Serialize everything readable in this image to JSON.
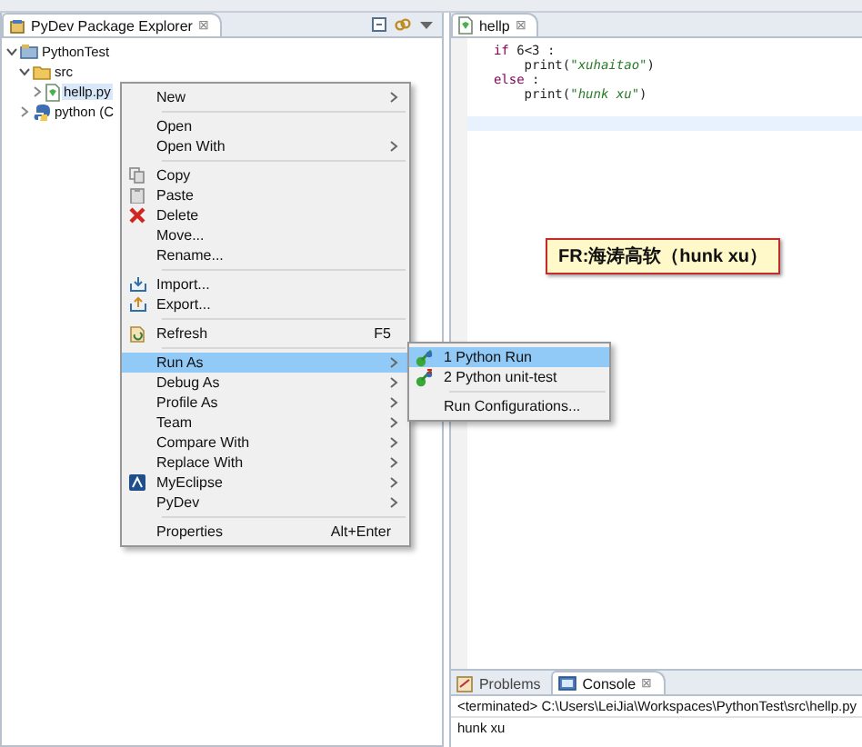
{
  "explorer": {
    "tab": {
      "label": "PyDev Package Explorer",
      "selected": true,
      "close": "⊠"
    },
    "tree": [
      {
        "label": "PythonTest",
        "kind": "project",
        "expanded": true,
        "selected": false,
        "children": [
          {
            "label": "src",
            "kind": "folder",
            "expanded": true,
            "selected": false,
            "children": [
              {
                "label": "hellp.py",
                "kind": "file",
                "expanded": false,
                "selected": true
              }
            ]
          },
          {
            "label": "python (C",
            "kind": "python",
            "expanded": false,
            "selected": false
          }
        ]
      }
    ]
  },
  "context_menu": [
    {
      "kind": "item",
      "label": "New",
      "submenu": true,
      "selected": false
    },
    {
      "kind": "separator"
    },
    {
      "kind": "item",
      "label": "Open",
      "submenu": false,
      "selected": false
    },
    {
      "kind": "item",
      "label": "Open With",
      "submenu": true,
      "selected": false
    },
    {
      "kind": "separator"
    },
    {
      "kind": "item",
      "label": "Copy",
      "submenu": false,
      "selected": false
    },
    {
      "kind": "item",
      "label": "Paste",
      "submenu": false,
      "selected": false
    },
    {
      "kind": "item",
      "label": "Delete",
      "submenu": false,
      "selected": false
    },
    {
      "kind": "item",
      "label": "Move...",
      "submenu": false,
      "selected": false
    },
    {
      "kind": "item",
      "label": "Rename...",
      "submenu": false,
      "selected": false
    },
    {
      "kind": "separator"
    },
    {
      "kind": "item",
      "label": "Import...",
      "submenu": false,
      "selected": false
    },
    {
      "kind": "item",
      "label": "Export...",
      "submenu": false,
      "selected": false
    },
    {
      "kind": "separator"
    },
    {
      "kind": "item",
      "label": "Refresh",
      "shortcut": "F5",
      "submenu": false,
      "selected": false
    },
    {
      "kind": "separator"
    },
    {
      "kind": "item",
      "label": "Run As",
      "submenu": true,
      "selected": true
    },
    {
      "kind": "item",
      "label": "Debug As",
      "submenu": true,
      "selected": false
    },
    {
      "kind": "item",
      "label": "Profile As",
      "submenu": true,
      "selected": false
    },
    {
      "kind": "item",
      "label": "Team",
      "submenu": true,
      "selected": false
    },
    {
      "kind": "item",
      "label": "Compare With",
      "submenu": true,
      "selected": false
    },
    {
      "kind": "item",
      "label": "Replace With",
      "submenu": true,
      "selected": false
    },
    {
      "kind": "item",
      "label": "MyEclipse",
      "submenu": true,
      "selected": false
    },
    {
      "kind": "item",
      "label": "PyDev",
      "submenu": true,
      "selected": false
    },
    {
      "kind": "separator"
    },
    {
      "kind": "item",
      "label": "Properties",
      "shortcut": "Alt+Enter",
      "submenu": false,
      "selected": false
    }
  ],
  "submenu": [
    {
      "kind": "item",
      "label": "1 Python Run",
      "selected": true
    },
    {
      "kind": "item",
      "label": "2 Python unit-test",
      "selected": false
    },
    {
      "kind": "separator"
    },
    {
      "kind": "item",
      "label": "Run Configurations...",
      "selected": false
    }
  ],
  "editor": {
    "tab": {
      "label": "hellp",
      "selected": true,
      "close": "⊠"
    },
    "lines": [
      {
        "current": false,
        "tokens": [
          {
            "kind": "keyword",
            "text": "if"
          },
          {
            "kind": "plain",
            "text": " 6<3 :"
          }
        ]
      },
      {
        "current": false,
        "tokens": [
          {
            "kind": "plain",
            "text": "    print("
          },
          {
            "kind": "string",
            "text": "\"xuhaitao\""
          },
          {
            "kind": "plain",
            "text": ")"
          }
        ]
      },
      {
        "current": false,
        "tokens": [
          {
            "kind": "keyword",
            "text": "else"
          },
          {
            "kind": "plain",
            "text": " :"
          }
        ]
      },
      {
        "current": false,
        "tokens": [
          {
            "kind": "plain",
            "text": "    print("
          },
          {
            "kind": "string",
            "text": "\"hunk xu\""
          },
          {
            "kind": "plain",
            "text": ")"
          }
        ]
      },
      {
        "current": true
      }
    ]
  },
  "note": "FR:海涛高软（hunk xu）",
  "console": {
    "tabs": [
      {
        "label": "Problems",
        "selected": false
      },
      {
        "label": "Console",
        "selected": true,
        "close": "⊠"
      }
    ],
    "header": "<terminated> C:\\Users\\LeiJia\\Workspaces\\PythonTest\\src\\hellp.py",
    "output": "hunk xu"
  }
}
